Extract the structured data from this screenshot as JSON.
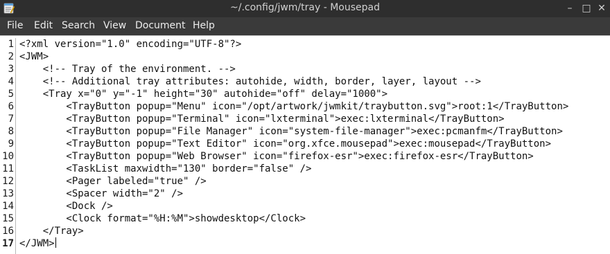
{
  "window": {
    "title": "~/.config/jwm/tray - Mousepad",
    "controls": {
      "minimize": "–",
      "maximize": "□",
      "close": "✕"
    }
  },
  "menubar": {
    "items": [
      "File",
      "Edit",
      "Search",
      "View",
      "Document",
      "Help"
    ]
  },
  "editor": {
    "current_line": 17,
    "line_numbers": [
      "1",
      "2",
      "3",
      "4",
      "5",
      "6",
      "7",
      "8",
      "9",
      "10",
      "11",
      "12",
      "13",
      "14",
      "15",
      "16",
      "17"
    ],
    "lines": [
      "<?xml version=\"1.0\" encoding=\"UTF-8\"?>",
      "<JWM>",
      "    <!-- Tray of the environment. -->",
      "    <!-- Additional tray attributes: autohide, width, border, layer, layout -->",
      "    <Tray x=\"0\" y=\"-1\" height=\"30\" autohide=\"off\" delay=\"1000\">",
      "        <TrayButton popup=\"Menu\" icon=\"/opt/artwork/jwmkit/traybutton.svg\">root:1</TrayButton>",
      "        <TrayButton popup=\"Terminal\" icon=\"lxterminal\">exec:lxterminal</TrayButton>",
      "        <TrayButton popup=\"File Manager\" icon=\"system-file-manager\">exec:pcmanfm</TrayButton>",
      "        <TrayButton popup=\"Text Editor\" icon=\"org.xfce.mousepad\">exec:mousepad</TrayButton>",
      "        <TrayButton popup=\"Web Browser\" icon=\"firefox-esr\">exec:firefox-esr</TrayButton>",
      "        <TaskList maxwidth=\"130\" border=\"false\" />",
      "        <Pager labeled=\"true\" />",
      "        <Spacer width=\"2\" />",
      "        <Dock />",
      "        <Clock format=\"%H:%M\">showdesktop</Clock>",
      "    </Tray>",
      "</JWM>"
    ]
  },
  "icons": {
    "app": "mousepad-icon",
    "minimize": "minimize-icon",
    "maximize": "maximize-icon",
    "close": "close-icon"
  },
  "colors": {
    "titlebar": "#2e2e2e",
    "menubar": "#3a3a3a",
    "editor_bg": "#ffffff",
    "text": "#111111"
  }
}
